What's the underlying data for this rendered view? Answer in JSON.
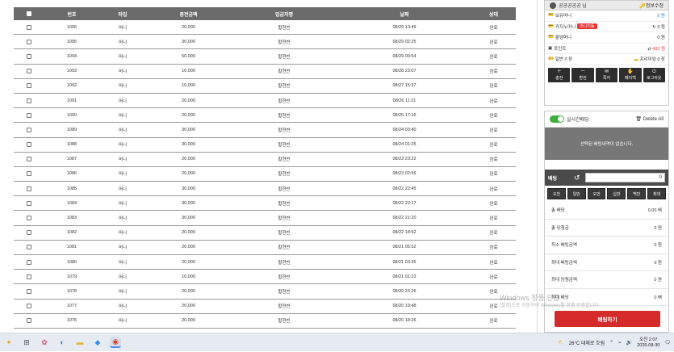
{
  "table": {
    "headers": [
      "번호",
      "타입",
      "충전금액",
      "입금자명",
      "날짜",
      "상태"
    ],
    "rows": [
      [
        "1096",
        "머니",
        "20,000",
        "황현빈",
        "08/29 13:49",
        "완료"
      ],
      [
        "1095",
        "머니",
        "30,000",
        "황현빈",
        "08/29 02:25",
        "완료"
      ],
      [
        "1094",
        "머니",
        "50,000",
        "황현빈",
        "08/29 00:54",
        "완료"
      ],
      [
        "1093",
        "머니",
        "10,000",
        "황현빈",
        "08/28 23:07",
        "완료"
      ],
      [
        "1092",
        "머니",
        "10,000",
        "황현빈",
        "08/27 15:37",
        "완료"
      ],
      [
        "1091",
        "머니",
        "20,000",
        "황현빈",
        "08/26 11:21",
        "완료"
      ],
      [
        "1090",
        "머니",
        "20,000",
        "황현빈",
        "08/25 17:16",
        "완료"
      ],
      [
        "1089",
        "머니",
        "30,000",
        "황현빈",
        "08/24 03:40",
        "완료"
      ],
      [
        "1088",
        "머니",
        "30,000",
        "황현빈",
        "08/24 01:25",
        "완료"
      ],
      [
        "1087",
        "머니",
        "20,000",
        "황현빈",
        "08/23 23:22",
        "완료"
      ],
      [
        "1086",
        "머니",
        "20,000",
        "황현빈",
        "08/23 02:56",
        "완료"
      ],
      [
        "1085",
        "머니",
        "30,000",
        "황현빈",
        "08/22 22:45",
        "완료"
      ],
      [
        "1084",
        "머니",
        "30,000",
        "황현빈",
        "08/22 22:17",
        "완료"
      ],
      [
        "1083",
        "머니",
        "30,000",
        "황현빈",
        "08/22 21:20",
        "완료"
      ],
      [
        "1082",
        "머니",
        "20,000",
        "황현빈",
        "08/22 18:52",
        "완료"
      ],
      [
        "1081",
        "머니",
        "20,000",
        "황현빈",
        "08/21 05:52",
        "완료"
      ],
      [
        "1080",
        "머니",
        "20,000",
        "황현빈",
        "08/21 03:35",
        "완료"
      ],
      [
        "1079",
        "머니",
        "10,000",
        "황현빈",
        "08/21 01:23",
        "완료"
      ],
      [
        "1078",
        "머니",
        "20,000",
        "황현빈",
        "08/20 23:26",
        "완료"
      ],
      [
        "1077",
        "머니",
        "20,000",
        "황현빈",
        "08/20 19:48",
        "완료"
      ],
      [
        "1076",
        "머니",
        "20,000",
        "황현빈",
        "08/20 18:26",
        "완료"
      ]
    ]
  },
  "user_panel": {
    "username": "공공공공공 님",
    "edit_label": "정보수정",
    "money_label": "보유머니",
    "money_value": "0 원",
    "casino_label": "카지노머니",
    "casino_badge": "머니이동",
    "casino_value": "0 원",
    "holdem_label": "홀덤머니",
    "holdem_value": "0 원",
    "point_label": "포인트",
    "point_value": "432 원",
    "coupon_label": "일반 0 장",
    "coupon_premium": "프리미엄 0 장",
    "buttons": [
      "충전",
      "환전",
      "쪽지",
      "페이백",
      "로그아웃"
    ]
  },
  "bet_panel": {
    "live_label": "실시간배당",
    "delete_all": "Delete All",
    "empty_text": "선택된 배팅내역이 없습니다.",
    "bet_label": "배팅",
    "bet_value": "0",
    "quick": [
      "오천",
      "일만",
      "오만",
      "십만",
      "백만",
      "최대"
    ],
    "stats": [
      {
        "label": "총 배당",
        "value": "0.00 배"
      },
      {
        "label": "총 당첨금",
        "value": "0 원"
      },
      {
        "label": "최소 배팅금액",
        "value": "0 원"
      },
      {
        "label": "최대 배팅금액",
        "value": "0 원"
      },
      {
        "label": "최대 당첨금액",
        "value": "0 원"
      },
      {
        "label": "최대 배당",
        "value": "0 배"
      }
    ],
    "bet_button": "배팅하기"
  },
  "watermark": {
    "line1": "Windows 정품 인증",
    "line2": "[설정]으로 이동하여 Windows를 정품 인증합니다."
  },
  "taskbar": {
    "weather": "26°C 대체로 흐림",
    "time": "오전 2:07",
    "date": "2026-08-30"
  },
  "colors": {
    "header_bg": "#6b6b6b",
    "accent_red": "#d42a2a",
    "toggle_green": "#3fae3f"
  }
}
